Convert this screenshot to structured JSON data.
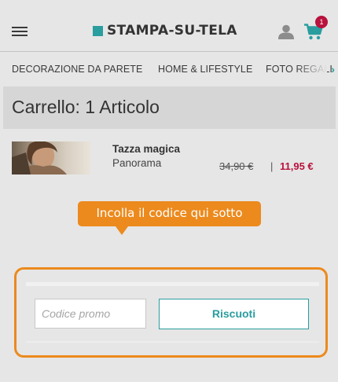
{
  "header": {
    "brand_name": "STAMPA-SU-TELA",
    "brand_color": "#2a9d9f",
    "icons": [
      "hamburger-menu-icon",
      "user-icon",
      "cart-icon"
    ],
    "cart_count": "1"
  },
  "nav": {
    "items": [
      {
        "label": "DECORAZIONE DA PARETE"
      },
      {
        "label": "HOME & LIFESTYLE"
      },
      {
        "label": "FOTO REGALI"
      }
    ],
    "next_arrow": "›"
  },
  "cart": {
    "title": "Carrello: 1 Articolo",
    "item": {
      "name": "Tazza magica",
      "variant": "Panorama",
      "price_old": "34,90 €",
      "separator": "|",
      "price_new": "11,95 €"
    }
  },
  "promo": {
    "tooltip": "Incolla il codice qui sotto",
    "input_placeholder": "Codice promo",
    "input_value": "",
    "button_label": "Riscuoti"
  },
  "colors": {
    "accent_orange": "#ec8a1d",
    "sale_red": "#b8123d",
    "background": "#e6e6e6"
  }
}
